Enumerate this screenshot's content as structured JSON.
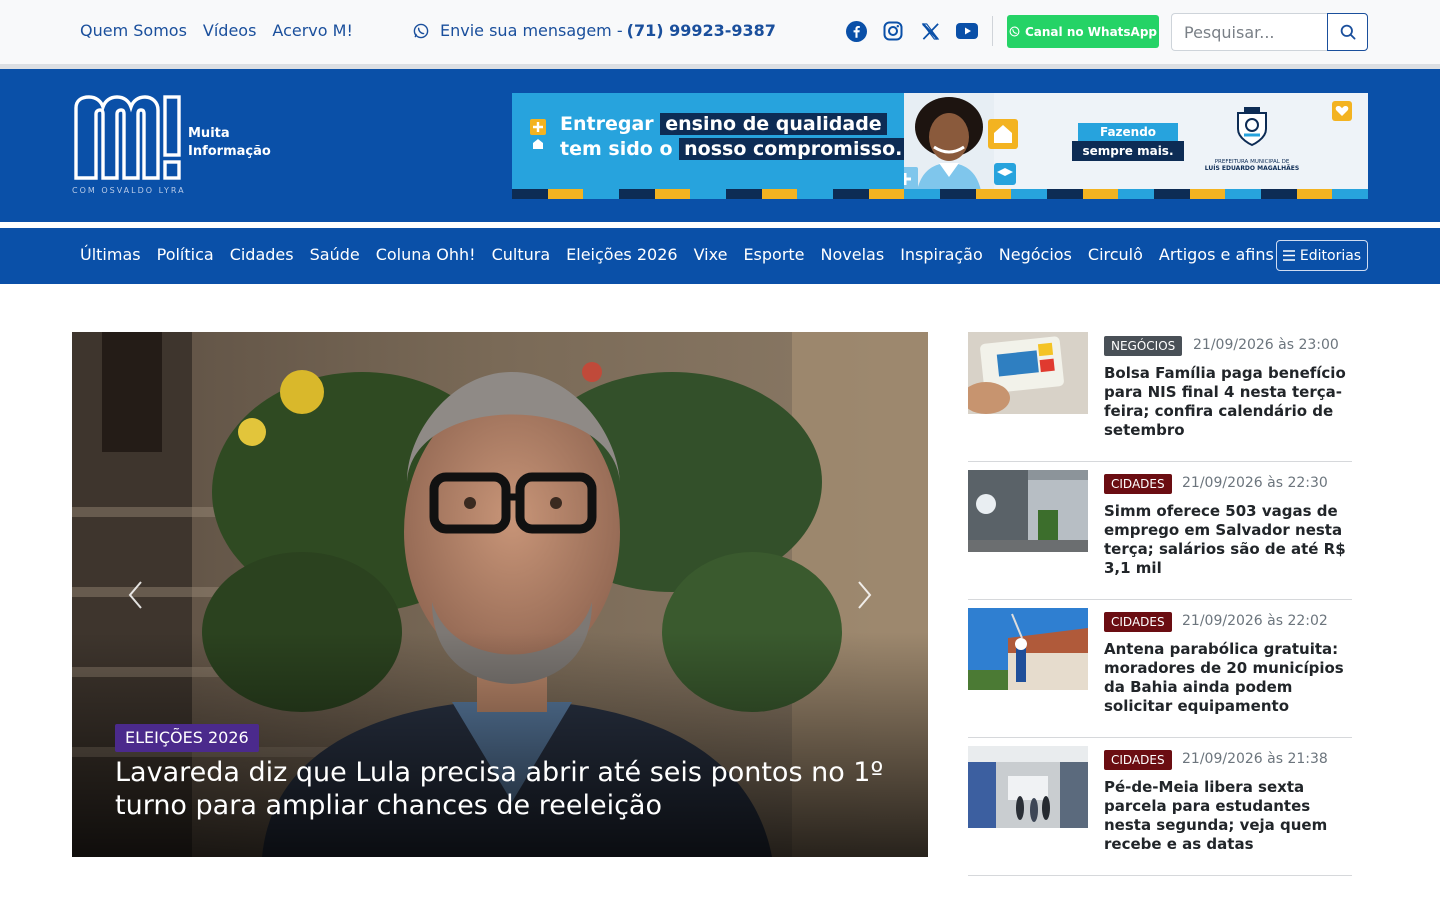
{
  "topbar": {
    "links": [
      "Quem Somos",
      "Vídeos",
      "Acervo M!"
    ],
    "message_prefix": "Envie sua mensagem -",
    "phone": "(71) 99923-9387",
    "socials": [
      "facebook-icon",
      "instagram-icon",
      "x-icon",
      "youtube-icon"
    ],
    "whatsapp_button": "Canal no WhatsApp",
    "search_placeholder": "Pesquisar..."
  },
  "header": {
    "logo_mark": "M!",
    "logo_line1": "Muita",
    "logo_line2": "Informação",
    "logo_sub": "COM OSVALDO LYRA",
    "banner": {
      "line1_a": "Entregar",
      "line1_b": "ensino de qualidade",
      "line2_a": "tem sido o",
      "line2_b": "nosso compromisso.",
      "slogan_a": "Fazendo",
      "slogan_b": "sempre mais.",
      "pref_line1": "PREFEITURA MUNICIPAL DE",
      "pref_line2": "LUÍS EDUARDO MAGALHÃES"
    }
  },
  "nav": {
    "items": [
      "Últimas",
      "Política",
      "Cidades",
      "Saúde",
      "Coluna Ohh!",
      "Cultura",
      "Eleições 2026",
      "Vixe",
      "Esporte",
      "Novelas",
      "Inspiração",
      "Negócios",
      "Circulô",
      "Artigos e afins"
    ],
    "editorias": "Editorias"
  },
  "hero": {
    "category": "ELEIÇÕES 2026",
    "title": "Lavareda diz que Lula precisa abrir até seis pontos no 1º turno para ampliar chances de reeleição"
  },
  "news": [
    {
      "category": "NEGÓCIOS",
      "date": "21/09/2026 às 23:00",
      "title": "Bolsa Família paga benefício para NIS final 4 nesta terça-feira; confira calendário de setembro"
    },
    {
      "category": "CIDADES",
      "date": "21/09/2026 às 22:30",
      "title": "Simm oferece 503 vagas de emprego em Salvador nesta terça; salários são de até R$ 3,1 mil"
    },
    {
      "category": "CIDADES",
      "date": "21/09/2026 às 22:02",
      "title": "Antena parabólica gratuita: moradores de 20 municípios da Bahia ainda podem solicitar equipamento"
    },
    {
      "category": "CIDADES",
      "date": "21/09/2026 às 21:38",
      "title": "Pé-de-Meia libera sexta parcela para estudantes nesta segunda; veja quem recebe e as datas"
    }
  ],
  "colors": {
    "brand_blue": "#0a50a8",
    "link_blue": "#1a4f9c",
    "whatsapp_green": "#25d366",
    "badge_politics": "#4b2a8c",
    "badge_cidades": "#6b0d12",
    "badge_negocios": "#495057"
  }
}
